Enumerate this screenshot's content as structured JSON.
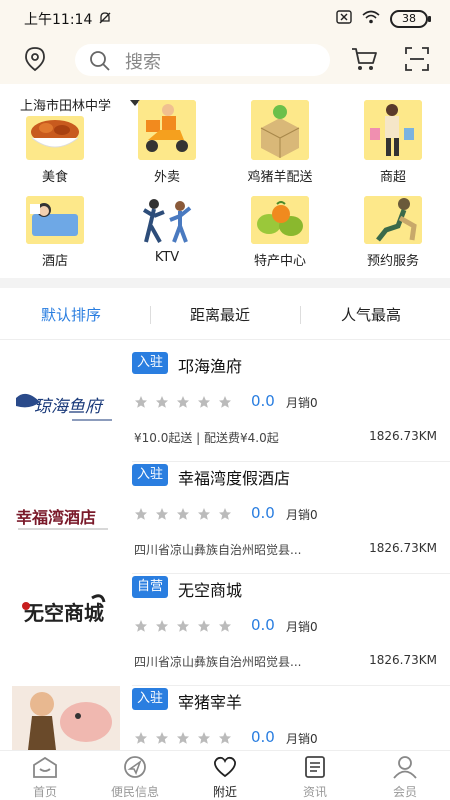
{
  "status": {
    "time": "上午11:14",
    "battery": "38"
  },
  "search": {
    "placeholder": "搜索"
  },
  "location": {
    "city": "上海市田林中学"
  },
  "categories": [
    {
      "label": "美食",
      "icon": "food-icon"
    },
    {
      "label": "外卖",
      "icon": "delivery-scooter-icon"
    },
    {
      "label": "鸡猪羊配送",
      "icon": "package-delivery-icon"
    },
    {
      "label": "商超",
      "icon": "shopping-icon"
    },
    {
      "label": "酒店",
      "icon": "hotel-bed-icon"
    },
    {
      "label": "KTV",
      "icon": "ktv-dance-icon"
    },
    {
      "label": "特产中心",
      "icon": "fruit-basket-icon"
    },
    {
      "label": "预约服务",
      "icon": "appointment-icon"
    }
  ],
  "sort": {
    "default": "默认排序",
    "nearest": "距离最近",
    "popular": "人气最高"
  },
  "shops": [
    {
      "badge": "入驻",
      "name": "邛海渔府",
      "rating": "0.0",
      "sales": "月销0",
      "info": "¥10.0起送 | 配送费¥4.0起",
      "distance": "1826.73KM",
      "logo_text": "琼海鱼府"
    },
    {
      "badge": "入驻",
      "name": "幸福湾度假酒店",
      "rating": "0.0",
      "sales": "月销0",
      "info": "四川省凉山彝族自治州昭觉县...",
      "distance": "1826.73KM",
      "logo_text": "幸福湾酒店"
    },
    {
      "badge": "自营",
      "name": "无空商城",
      "rating": "0.0",
      "sales": "月销0",
      "info": "四川省凉山彝族自治州昭觉县...",
      "distance": "1826.73KM",
      "logo_text": "无空商城"
    },
    {
      "badge": "入驻",
      "name": "宰猪宰羊",
      "rating": "0.0",
      "sales": "月销0",
      "info": "",
      "distance": "",
      "logo_text": ""
    }
  ],
  "tabbar": {
    "home": "首页",
    "info": "便民信息",
    "nearby": "附近",
    "news": "资讯",
    "member": "会员"
  },
  "colors": {
    "accent": "#2a7ee0",
    "header_bg": "#fbf7ef"
  }
}
